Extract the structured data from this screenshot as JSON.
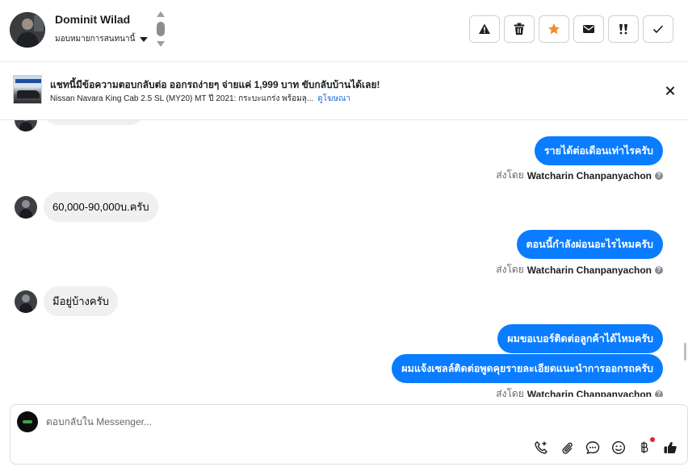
{
  "header": {
    "contact_name": "Dominit Wilad",
    "assign_label": "มอบหมายการสนทนานี้",
    "actions": [
      {
        "name": "report-spam-button",
        "icon": "warning-icon"
      },
      {
        "name": "delete-button",
        "icon": "trash-icon"
      },
      {
        "name": "star-button",
        "icon": "star-icon"
      },
      {
        "name": "mark-unread-button",
        "icon": "envelope-icon"
      },
      {
        "name": "follow-up-button",
        "icon": "exclamation-icon"
      },
      {
        "name": "mark-done-button",
        "icon": "check-icon"
      }
    ]
  },
  "ad": {
    "headline": "แชทนี้มีข้อความตอบกลับต่อ ออกรถง่ายๆ จ่ายแค่ 1,999 บาท ขับกลับบ้านได้เลย!",
    "subtext": "Nissan Navara King Cab 2.5 SL (MY20) MT ปี 2021: กระบะแกร่ง พร้อมลุ...",
    "link": "ดูโฆษณา"
  },
  "conversation": {
    "messages": [
      {
        "from": "agent",
        "text": "รายได้ต่อเดือนเท่าไรครับ"
      },
      {
        "from": "customer",
        "text": "60,000-90,000บ.ครับ"
      },
      {
        "from": "agent",
        "text": "ตอนนี้กำลังผ่อนอะไรไหมครับ"
      },
      {
        "from": "customer",
        "text": "มีอยู่บ้างครับ"
      },
      {
        "from": "agent",
        "text": "ผมขอเบอร์ติดต่อลูกค้าได้ไหมครับ"
      },
      {
        "from": "agent",
        "text": "ผมแจ้งเซลล์ติดต่อพูดคุยรายละเอียดแนะนำการออกรถครับ"
      }
    ],
    "sent_by_prefix": "ส่งโดย",
    "sent_by_name": "Watcharin Chanpanyachon",
    "help_glyph": "?"
  },
  "composer": {
    "placeholder": "ตอบกลับใน Messenger...",
    "tools": [
      "call-add-icon",
      "paperclip-icon",
      "chat-bubble-icon",
      "smiley-icon",
      "baht-icon",
      "thumbs-up-icon"
    ]
  },
  "colors": {
    "outgoing_bubble": "#0a7cff",
    "incoming_bubble": "#f0f0f0",
    "star": "#f28c28",
    "link": "#216fdb",
    "notification_dot": "#e41e3f"
  }
}
